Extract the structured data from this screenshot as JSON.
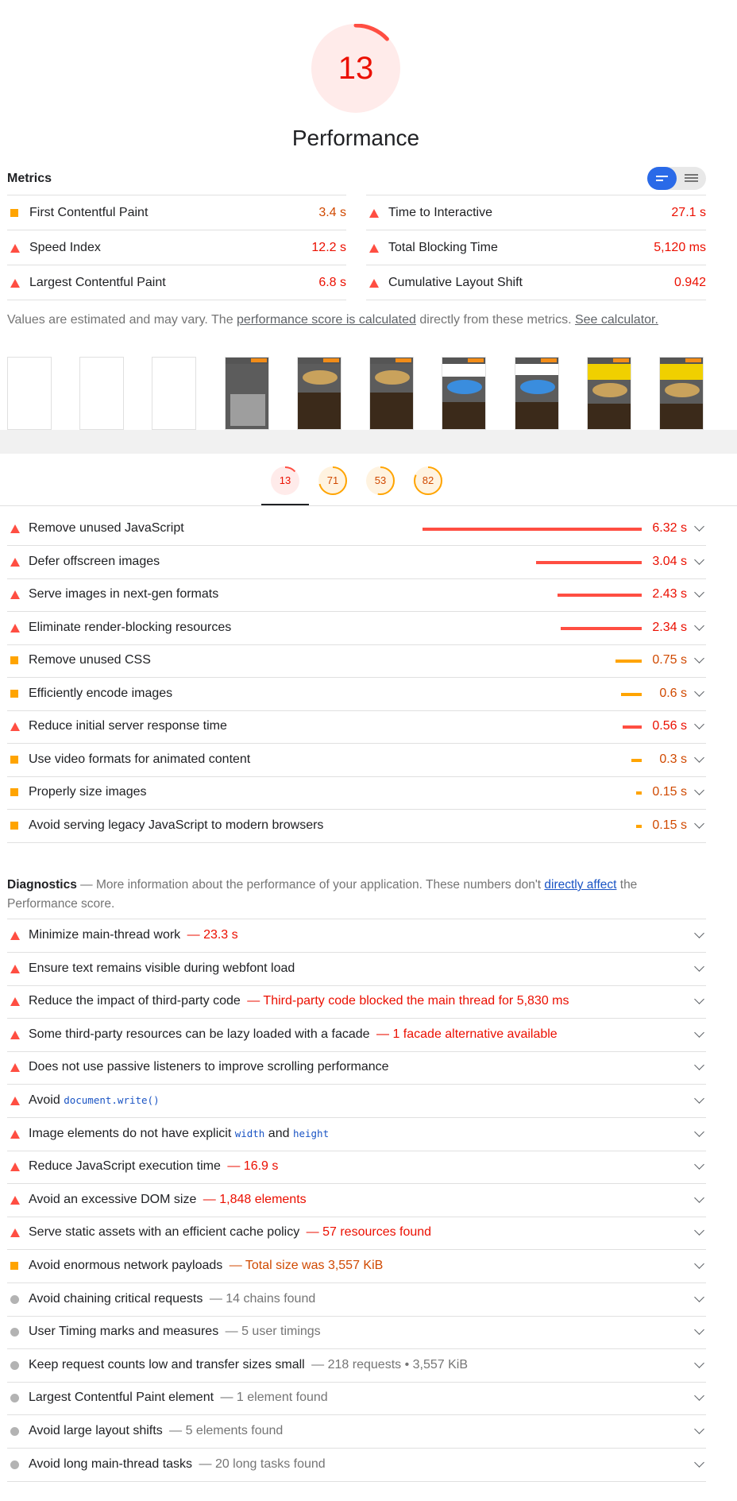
{
  "score": {
    "value": "13",
    "fraction": 0.13,
    "color": "#ff4e42"
  },
  "category_title": "Performance",
  "metrics": {
    "heading": "Metrics",
    "left": [
      {
        "icon": "square",
        "label": "First Contentful Paint",
        "value": "3.4 s",
        "level": "average"
      },
      {
        "icon": "triangle",
        "label": "Speed Index",
        "value": "12.2 s",
        "level": "fail"
      },
      {
        "icon": "triangle",
        "label": "Largest Contentful Paint",
        "value": "6.8 s",
        "level": "fail"
      }
    ],
    "right": [
      {
        "icon": "triangle",
        "label": "Time to Interactive",
        "value": "27.1 s",
        "level": "fail"
      },
      {
        "icon": "triangle",
        "label": "Total Blocking Time",
        "value": "5,120 ms",
        "level": "fail"
      },
      {
        "icon": "triangle",
        "label": "Cumulative Layout Shift",
        "value": "0.942",
        "level": "fail"
      }
    ]
  },
  "note": {
    "prefix": "Values are estimated and may vary. The ",
    "link1": "performance score is calculated",
    "middle": " directly from these metrics. ",
    "link2": "See calculator."
  },
  "tabs": [
    {
      "score": "13",
      "fraction": 0.13,
      "color": "#ff4e42",
      "bg": "#ffebea",
      "text": "#eb0f00"
    },
    {
      "score": "71",
      "fraction": 0.71,
      "color": "#ffa400",
      "bg": "#fff3e0",
      "text": "#d04900"
    },
    {
      "score": "53",
      "fraction": 0.53,
      "color": "#ffa400",
      "bg": "#fff3e0",
      "text": "#d04900"
    },
    {
      "score": "82",
      "fraction": 0.82,
      "color": "#ffa400",
      "bg": "#fff3e0",
      "text": "#d04900"
    }
  ],
  "opportunities": [
    {
      "icon": "triangle",
      "label": "Remove unused JavaScript",
      "savings_s": 6.32,
      "value": "6.32 s",
      "level": "fail"
    },
    {
      "icon": "triangle",
      "label": "Defer offscreen images",
      "savings_s": 3.04,
      "value": "3.04 s",
      "level": "fail"
    },
    {
      "icon": "triangle",
      "label": "Serve images in next-gen formats",
      "savings_s": 2.43,
      "value": "2.43 s",
      "level": "fail"
    },
    {
      "icon": "triangle",
      "label": "Eliminate render-blocking resources",
      "savings_s": 2.34,
      "value": "2.34 s",
      "level": "fail"
    },
    {
      "icon": "square",
      "label": "Remove unused CSS",
      "savings_s": 0.75,
      "value": "0.75 s",
      "level": "average"
    },
    {
      "icon": "square",
      "label": "Efficiently encode images",
      "savings_s": 0.6,
      "value": "0.6 s",
      "level": "average"
    },
    {
      "icon": "triangle",
      "label": "Reduce initial server response time",
      "savings_s": 0.56,
      "value": "0.56 s",
      "level": "fail"
    },
    {
      "icon": "square",
      "label": "Use video formats for animated content",
      "savings_s": 0.3,
      "value": "0.3 s",
      "level": "average"
    },
    {
      "icon": "square",
      "label": "Properly size images",
      "savings_s": 0.15,
      "value": "0.15 s",
      "level": "average"
    },
    {
      "icon": "square",
      "label": "Avoid serving legacy JavaScript to modern browsers",
      "savings_s": 0.15,
      "value": "0.15 s",
      "level": "average"
    }
  ],
  "diagnostics": {
    "title": "Diagnostics",
    "desc_prefix": " — More information about the performance of your application. These numbers don't ",
    "desc_link": "directly affect",
    "desc_suffix": " the Performance score.",
    "items": [
      {
        "icon": "triangle",
        "label": "Minimize main-thread work",
        "detail": " — 23.3 s",
        "level": "fail"
      },
      {
        "icon": "triangle",
        "label": "Ensure text remains visible during webfont load",
        "detail": "",
        "level": "fail"
      },
      {
        "icon": "triangle",
        "label": "Reduce the impact of third-party code",
        "detail": " — Third-party code blocked the main thread for 5,830 ms",
        "level": "fail"
      },
      {
        "icon": "triangle",
        "label": "Some third-party resources can be lazy loaded with a facade",
        "detail": " — 1 facade alternative available",
        "level": "fail"
      },
      {
        "icon": "triangle",
        "label": "Does not use passive listeners to improve scrolling performance",
        "detail": "",
        "level": "fail"
      },
      {
        "icon": "triangle",
        "label": "Avoid ",
        "code": "document.write()",
        "detail": "",
        "level": "fail"
      },
      {
        "icon": "triangle",
        "label": "Image elements do not have explicit ",
        "code": "width",
        "mid": " and ",
        "code2": "height",
        "detail": "",
        "level": "fail"
      },
      {
        "icon": "triangle",
        "label": "Reduce JavaScript execution time",
        "detail": " — 16.9 s",
        "level": "fail"
      },
      {
        "icon": "triangle",
        "label": "Avoid an excessive DOM size",
        "detail": " — 1,848 elements",
        "level": "fail"
      },
      {
        "icon": "triangle",
        "label": "Serve static assets with an efficient cache policy",
        "detail": " — 57 resources found",
        "level": "fail"
      },
      {
        "icon": "square",
        "label": "Avoid enormous network payloads",
        "detail": " — Total size was 3,557 KiB",
        "level": "average"
      },
      {
        "icon": "circle",
        "label": "Avoid chaining critical requests",
        "detail": " — 14 chains found",
        "level": "info"
      },
      {
        "icon": "circle",
        "label": "User Timing marks and measures",
        "detail": " — 5 user timings",
        "level": "info"
      },
      {
        "icon": "circle",
        "label": "Keep request counts low and transfer sizes small",
        "detail": " — 218 requests • 3,557 KiB",
        "level": "info"
      },
      {
        "icon": "circle",
        "label": "Largest Contentful Paint element",
        "detail": " — 1 element found",
        "level": "info"
      },
      {
        "icon": "circle",
        "label": "Avoid large layout shifts",
        "detail": " — 5 elements found",
        "level": "info"
      },
      {
        "icon": "circle",
        "label": "Avoid long main-thread tasks",
        "detail": " — 20 long tasks found",
        "level": "info"
      }
    ]
  },
  "colors": {
    "fail": "#eb0f00",
    "average": "#d04900",
    "info": "#757575",
    "fail_icon": "#ff4e42",
    "average_icon": "#ffa400",
    "info_icon": "#b3b3b3",
    "link": "#1a54c4",
    "toggle_active": "#2a6ae8"
  }
}
